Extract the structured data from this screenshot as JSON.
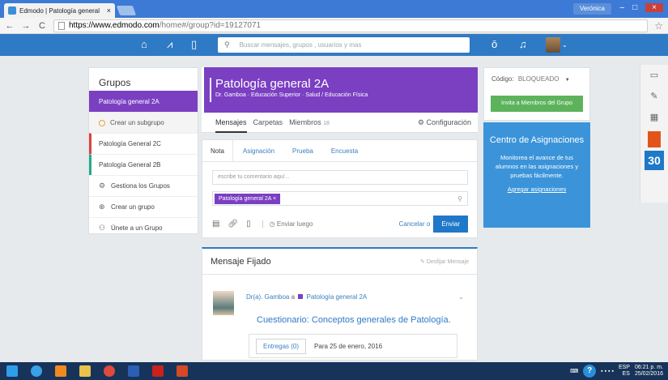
{
  "browser": {
    "tab_title": "Edmodo | Patología general",
    "tab_close": "×",
    "user": "Verónica",
    "url_host": "https://www.edmodo.com",
    "url_rest": "/home#/group?id=19127071",
    "win_min": "–",
    "win_max": "□",
    "win_close": "×"
  },
  "header": {
    "search_placeholder": "Buscar mensajes, grupos , usuarios y mas"
  },
  "groups": {
    "title": "Grupos",
    "items": [
      {
        "label": "Patología general 2A"
      },
      {
        "label": "Crear un subgrupo"
      },
      {
        "label": "Patología General 2C"
      },
      {
        "label": "Patología General 2B"
      },
      {
        "label": "Gestiona los Grupos"
      },
      {
        "label": "Crear un grupo"
      },
      {
        "label": "Únete a un Grupo"
      }
    ]
  },
  "group": {
    "title": "Patología general 2A",
    "subtitle": "Dr. Gamboa · Educación Superior · Salud / Educación Física",
    "tabs": {
      "messages": "Mensajes",
      "folders": "Carpetas",
      "members": "Miembros",
      "members_count": "18",
      "settings": "Configuración"
    }
  },
  "composer": {
    "tabs": [
      "Nota",
      "Asignación",
      "Prueba",
      "Encuesta"
    ],
    "placeholder": "escribe tu comentario aquí...",
    "recipient": "Patología general 2A",
    "recipient_x": "×",
    "send_later": "Enviar luego",
    "cancel": "Cancelar o",
    "send": "Enviar"
  },
  "pinned": {
    "title": "Mensaje Fijado",
    "unpin": "Desfijar Mensaje",
    "author": "Dr(a). Gamboa",
    "to": "a",
    "group": "Patología general 2A",
    "post_title": "Cuestionario: Conceptos generales de Patología.",
    "submissions": "Entregas (0)",
    "due": "Para 25 de enero, 2016"
  },
  "right": {
    "code_label": "Código:",
    "code_value": "BLOQUEADO",
    "invite": "Invita a Miembros del Grupo",
    "promo_title": "Centro de Asignaciones",
    "promo_desc": "Monitorea el avance de tus alumnos en las asignaciones y pruebas fácilmente.",
    "promo_link": "Agregar asignaciones"
  },
  "sidebar": {
    "calendar_day": "30"
  },
  "taskbar": {
    "lang": "ESP",
    "lang2": "ES",
    "time": "06:21 p. m.",
    "date": "25/02/2016"
  },
  "colors": {
    "brand_blue": "#2f7ac4",
    "group_purple": "#7b3fc2",
    "invite_green": "#5cb35c"
  }
}
